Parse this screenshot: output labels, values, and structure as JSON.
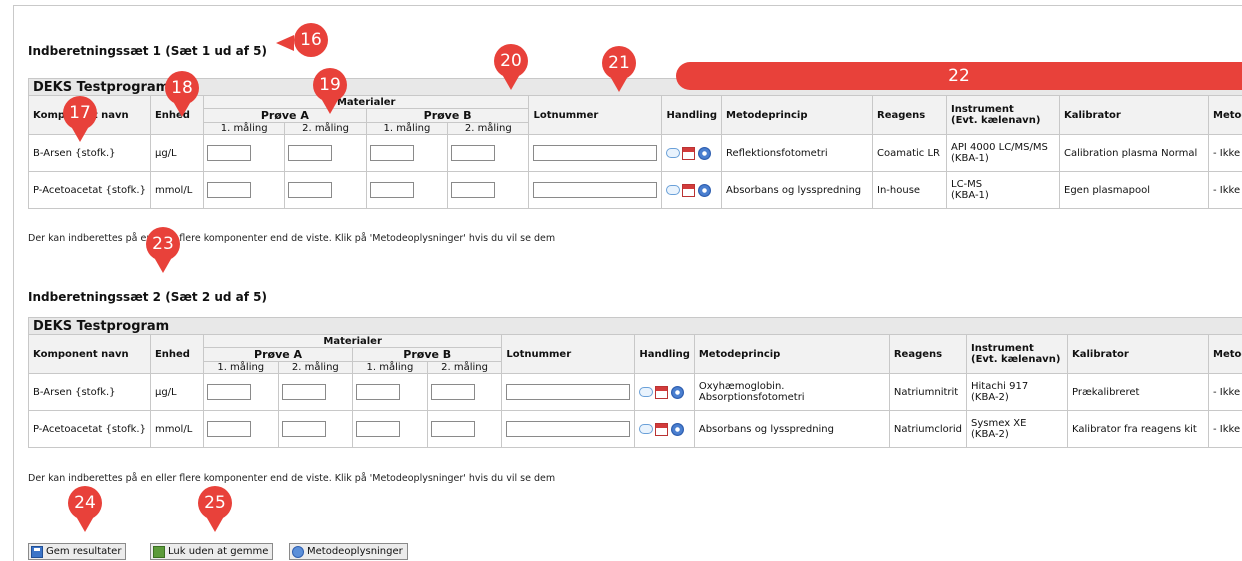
{
  "sets": [
    {
      "heading": "Indberetningssæt 1 (Sæt 1 ud af 5)",
      "program": "DEKS Testprogram",
      "headers": {
        "component": "Komponent navn",
        "unit": "Enhed",
        "materials": "Materialer",
        "sampleA": "Prøve A",
        "sampleB": "Prøve B",
        "measurement1": "1. måling",
        "measurement2": "2. måling",
        "lot": "Lotnummer",
        "action": "Handling",
        "principle": "Metodeprincip",
        "reagent": "Reagens",
        "instrument_line1": "Instrument",
        "instrument_line2": "(Evt. kælenavn)",
        "calibrator": "Kalibrator",
        "methodgroup": "Metodegruppe"
      },
      "rows": [
        {
          "component": "B-Arsen {stofk.}",
          "unit": "µg/L",
          "principle": "Reflektionsfotometri",
          "reagent": "Coamatic LR",
          "instrument_line1": "API 4000 LC/MS/MS",
          "instrument_line2": "(KBA-1)",
          "calibrator": "Calibration plasma Normal",
          "methodgroup": "- Ikke oprettet end"
        },
        {
          "component": "P-Acetoacetat {stofk.}",
          "unit": "mmol/L",
          "principle": "Absorbans og lysspredning",
          "reagent": "In-house",
          "instrument_line1": "LC-MS",
          "instrument_line2": "(KBA-1)",
          "calibrator": "Egen plasmapool",
          "methodgroup": "- Ikke oprettet end"
        }
      ],
      "note": "Der kan indberettes på en eller flere komponenter end de viste. Klik på 'Metodeoplysninger' hvis du vil se dem"
    },
    {
      "heading": "Indberetningssæt 2 (Sæt 2 ud af 5)",
      "program": "DEKS Testprogram",
      "headers": {
        "component": "Komponent navn",
        "unit": "Enhed",
        "materials": "Materialer",
        "sampleA": "Prøve A",
        "sampleB": "Prøve B",
        "measurement1": "1. måling",
        "measurement2": "2. måling",
        "lot": "Lotnummer",
        "action": "Handling",
        "principle": "Metodeprincip",
        "reagent": "Reagens",
        "instrument_line1": "Instrument",
        "instrument_line2": "(Evt. kælenavn)",
        "calibrator": "Kalibrator",
        "methodgroup": "Metodegruppe"
      },
      "rows": [
        {
          "component": "B-Arsen {stofk.}",
          "unit": "µg/L",
          "principle": "Oxyhæmoglobin. Absorptionsfotometri",
          "principle_line1": "Oxyhæmoglobin.",
          "principle_line2": "Absorptionsfotometri",
          "reagent": "Natriumnitrit",
          "instrument_line1": "Hitachi 917",
          "instrument_line2": "(KBA-2)",
          "calibrator": "Prækalibreret",
          "methodgroup": "- Ikke opret"
        },
        {
          "component": "P-Acetoacetat {stofk.}",
          "unit": "mmol/L",
          "principle": "Absorbans og lysspredning",
          "reagent": "Natriumclorid",
          "instrument_line1": "Sysmex XE",
          "instrument_line2": "(KBA-2)",
          "calibrator": "Kalibrator fra reagens kit",
          "methodgroup": "- Ikke opret"
        }
      ],
      "note": "Der kan indberettes på en eller flere komponenter end de viste. Klik på 'Metodeoplysninger' hvis du vil se dem"
    }
  ],
  "buttons": {
    "save": "Gem resultater",
    "close": "Luk uden at gemme",
    "info": "Metodeoplysninger"
  },
  "callouts": [
    "16",
    "17",
    "18",
    "19",
    "20",
    "21",
    "22",
    "23",
    "24",
    "25"
  ],
  "colors": {
    "callout": "#e8413a",
    "header_bg": "#e8e8e8",
    "border": "#c8c8c8"
  }
}
